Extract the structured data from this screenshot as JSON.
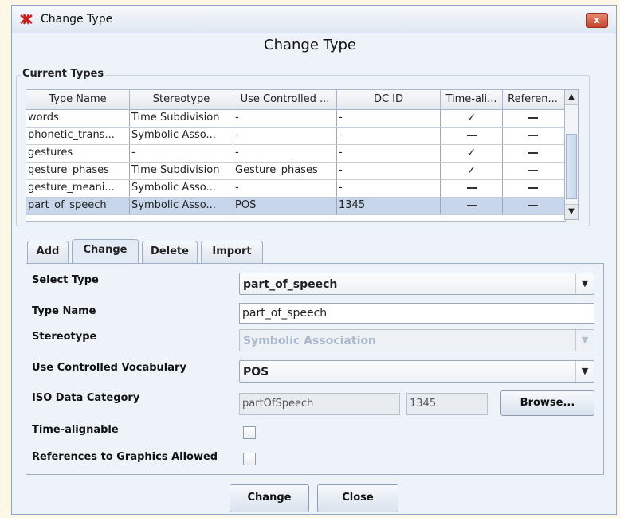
{
  "window": {
    "title": "Change Type",
    "close": "x"
  },
  "dialog": {
    "heading": "Change Type"
  },
  "current_types": {
    "group_label": "Current Types",
    "columns": [
      "Type Name",
      "Stereotype",
      "Use Controlled ...",
      "DC ID",
      "Time-ali...",
      "Referen..."
    ],
    "rows": [
      {
        "name": "words",
        "stereotype": "Time Subdivision",
        "cv": "-",
        "dcid": "-",
        "time": true,
        "ref": false
      },
      {
        "name": "phonetic_trans...",
        "stereotype": "Symbolic Asso...",
        "cv": "-",
        "dcid": "-",
        "time": false,
        "ref": false
      },
      {
        "name": "gestures",
        "stereotype": "-",
        "cv": "-",
        "dcid": "-",
        "time": true,
        "ref": false
      },
      {
        "name": "gesture_phases",
        "stereotype": "Time Subdivision",
        "cv": "Gesture_phases",
        "dcid": "-",
        "time": true,
        "ref": false
      },
      {
        "name": "gesture_meani...",
        "stereotype": "Symbolic Asso...",
        "cv": "-",
        "dcid": "-",
        "time": false,
        "ref": false
      },
      {
        "name": "part_of_speech",
        "stereotype": "Symbolic Asso...",
        "cv": "POS",
        "dcid": "1345",
        "time": false,
        "ref": false,
        "selected": true
      }
    ]
  },
  "tabs": [
    "Add",
    "Change",
    "Delete",
    "Import"
  ],
  "active_tab": "Change",
  "form": {
    "select_type_label": "Select Type",
    "select_type_value": "part_of_speech",
    "type_name_label": "Type Name",
    "type_name_value": "part_of_speech",
    "stereotype_label": "Stereotype",
    "stereotype_value": "Symbolic Association",
    "cv_label": "Use Controlled Vocabulary",
    "cv_value": "POS",
    "iso_label": "ISO Data Category",
    "iso_name": "partOfSpeech",
    "iso_id": "1345",
    "browse_label": "Browse...",
    "time_alignable_label": "Time-alignable",
    "time_alignable_checked": false,
    "references_label": "References to Graphics Allowed",
    "references_checked": false
  },
  "buttons": {
    "change": "Change",
    "close": "Close"
  }
}
